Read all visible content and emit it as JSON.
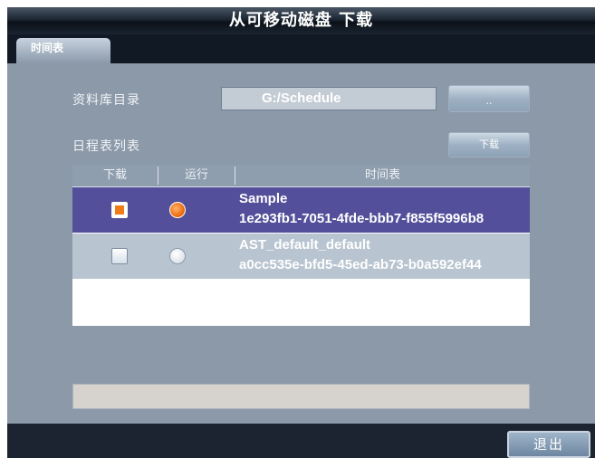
{
  "window": {
    "title": "从可移动磁盘 下载"
  },
  "tabs": [
    {
      "label": "时间表"
    }
  ],
  "library": {
    "label": "资料库目录",
    "path": "G:/Schedule",
    "browse_label": ".."
  },
  "schedule_list": {
    "label": "日程表列表",
    "download_label": "下载",
    "columns": [
      "下载",
      "运行",
      "时间表"
    ],
    "rows": [
      {
        "name": "Sample",
        "id": "1e293fb1-7051-4fde-bbb7-f855f5996b8",
        "download_checked": true,
        "run_selected": true
      },
      {
        "name": "AST_default_default",
        "id": "a0cc535e-bfd5-45ed-ab73-b0a592ef44",
        "download_checked": false,
        "run_selected": false
      }
    ]
  },
  "footer": {
    "exit_label": "退出"
  },
  "colors": {
    "selected_row": "#534f9a",
    "accent_orange": "#f07b17",
    "panel": "#8b99a9"
  }
}
